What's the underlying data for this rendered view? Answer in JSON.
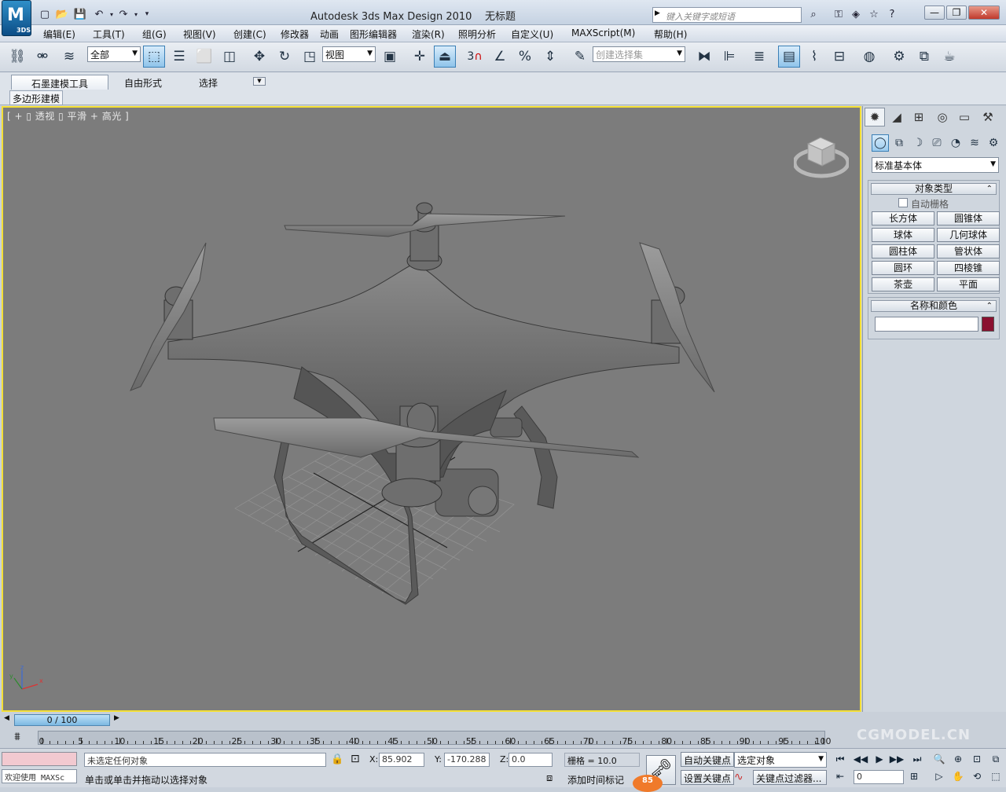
{
  "app": {
    "title": "Autodesk 3ds Max Design 2010",
    "document": "无标题",
    "logo_text": "3DS",
    "logo_letter": "M",
    "search_placeholder": "键入关键字或短语"
  },
  "menu": [
    "编辑(E)",
    "工具(T)",
    "组(G)",
    "视图(V)",
    "创建(C)",
    "修改器",
    "动画",
    "图形编辑器",
    "渲染(R)",
    "照明分析",
    "自定义(U)",
    "MAXScript(M)",
    "帮助(H)"
  ],
  "toolbar": {
    "selection_filter": "全部",
    "ref_coord": "视图",
    "snap_label": "3",
    "named_selection_placeholder": "创建选择集"
  },
  "ribbon": {
    "tabs": [
      "石墨建模工具",
      "自由形式",
      "选择"
    ],
    "panel": "多边形建模"
  },
  "viewport": {
    "label": "[ + ▯ 透视 ▯ 平滑 + 高光 ]"
  },
  "command_panel": {
    "category": "标准基本体",
    "object_type_header": "对象类型",
    "autogrid_label": "自动栅格",
    "buttons": [
      "长方体",
      "圆锥体",
      "球体",
      "几何球体",
      "圆柱体",
      "管状体",
      "圆环",
      "四棱锥",
      "茶壶",
      "平面"
    ],
    "name_color_header": "名称和颜色",
    "object_color": "#8a1030"
  },
  "time": {
    "slider": "0 / 100",
    "ticks": [
      "0",
      "5",
      "10",
      "15",
      "20",
      "25",
      "30",
      "35",
      "40",
      "45",
      "50",
      "55",
      "60",
      "65",
      "70",
      "75",
      "80",
      "85",
      "90",
      "95",
      "100"
    ]
  },
  "status": {
    "maxscript": "欢迎使用 MAXSc",
    "selection": "未选定任何对象",
    "prompt": "单击或单击并拖动以选择对象",
    "x_label": "X:",
    "x_value": "85.902",
    "y_label": "Y:",
    "y_value": "-170.288",
    "z_label": "Z:",
    "z_value": "0.0",
    "grid": "栅格 = 10.0",
    "add_time_tag": "添加时间标记",
    "auto_key": "自动关键点",
    "set_key": "设置关键点",
    "key_mode": "选定对象",
    "key_filters": "关键点过滤器...",
    "frame": "0",
    "badge": "85"
  },
  "watermark": "CGMODEL.CN"
}
